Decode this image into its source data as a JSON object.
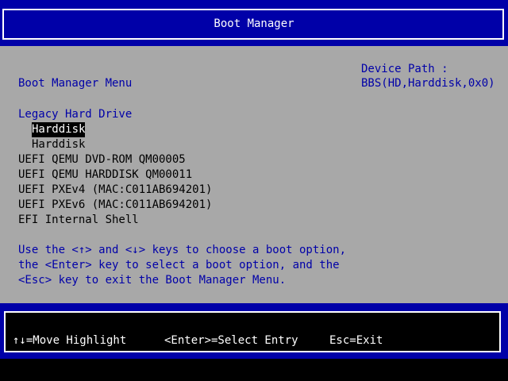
{
  "title": "Boot Manager",
  "menu_title": "Boot Manager Menu",
  "device_path_label": "Device Path :",
  "device_path_value": "BBS(HD,Harddisk,0x0)",
  "boot_entries": {
    "legacy_group": "Legacy Hard Drive",
    "legacy_items": [
      "Harddisk",
      "Harddisk"
    ],
    "uefi_items": [
      "UEFI QEMU DVD-ROM QM00005",
      "UEFI QEMU HARDDISK QM00011",
      "UEFI PXEv4 (MAC:C011AB694201)",
      "UEFI PXEv6 (MAC:C011AB694201)",
      "EFI Internal Shell"
    ]
  },
  "help_lines": [
    "Use the <↑> and <↓> keys to choose a boot option,",
    "the <Enter> key to select a boot option, and the",
    "<Esc> key to exit the Boot Manager Menu."
  ],
  "footer": {
    "move": "↑↓=Move Highlight",
    "select": "<Enter>=Select Entry",
    "exit": "Esc=Exit"
  }
}
